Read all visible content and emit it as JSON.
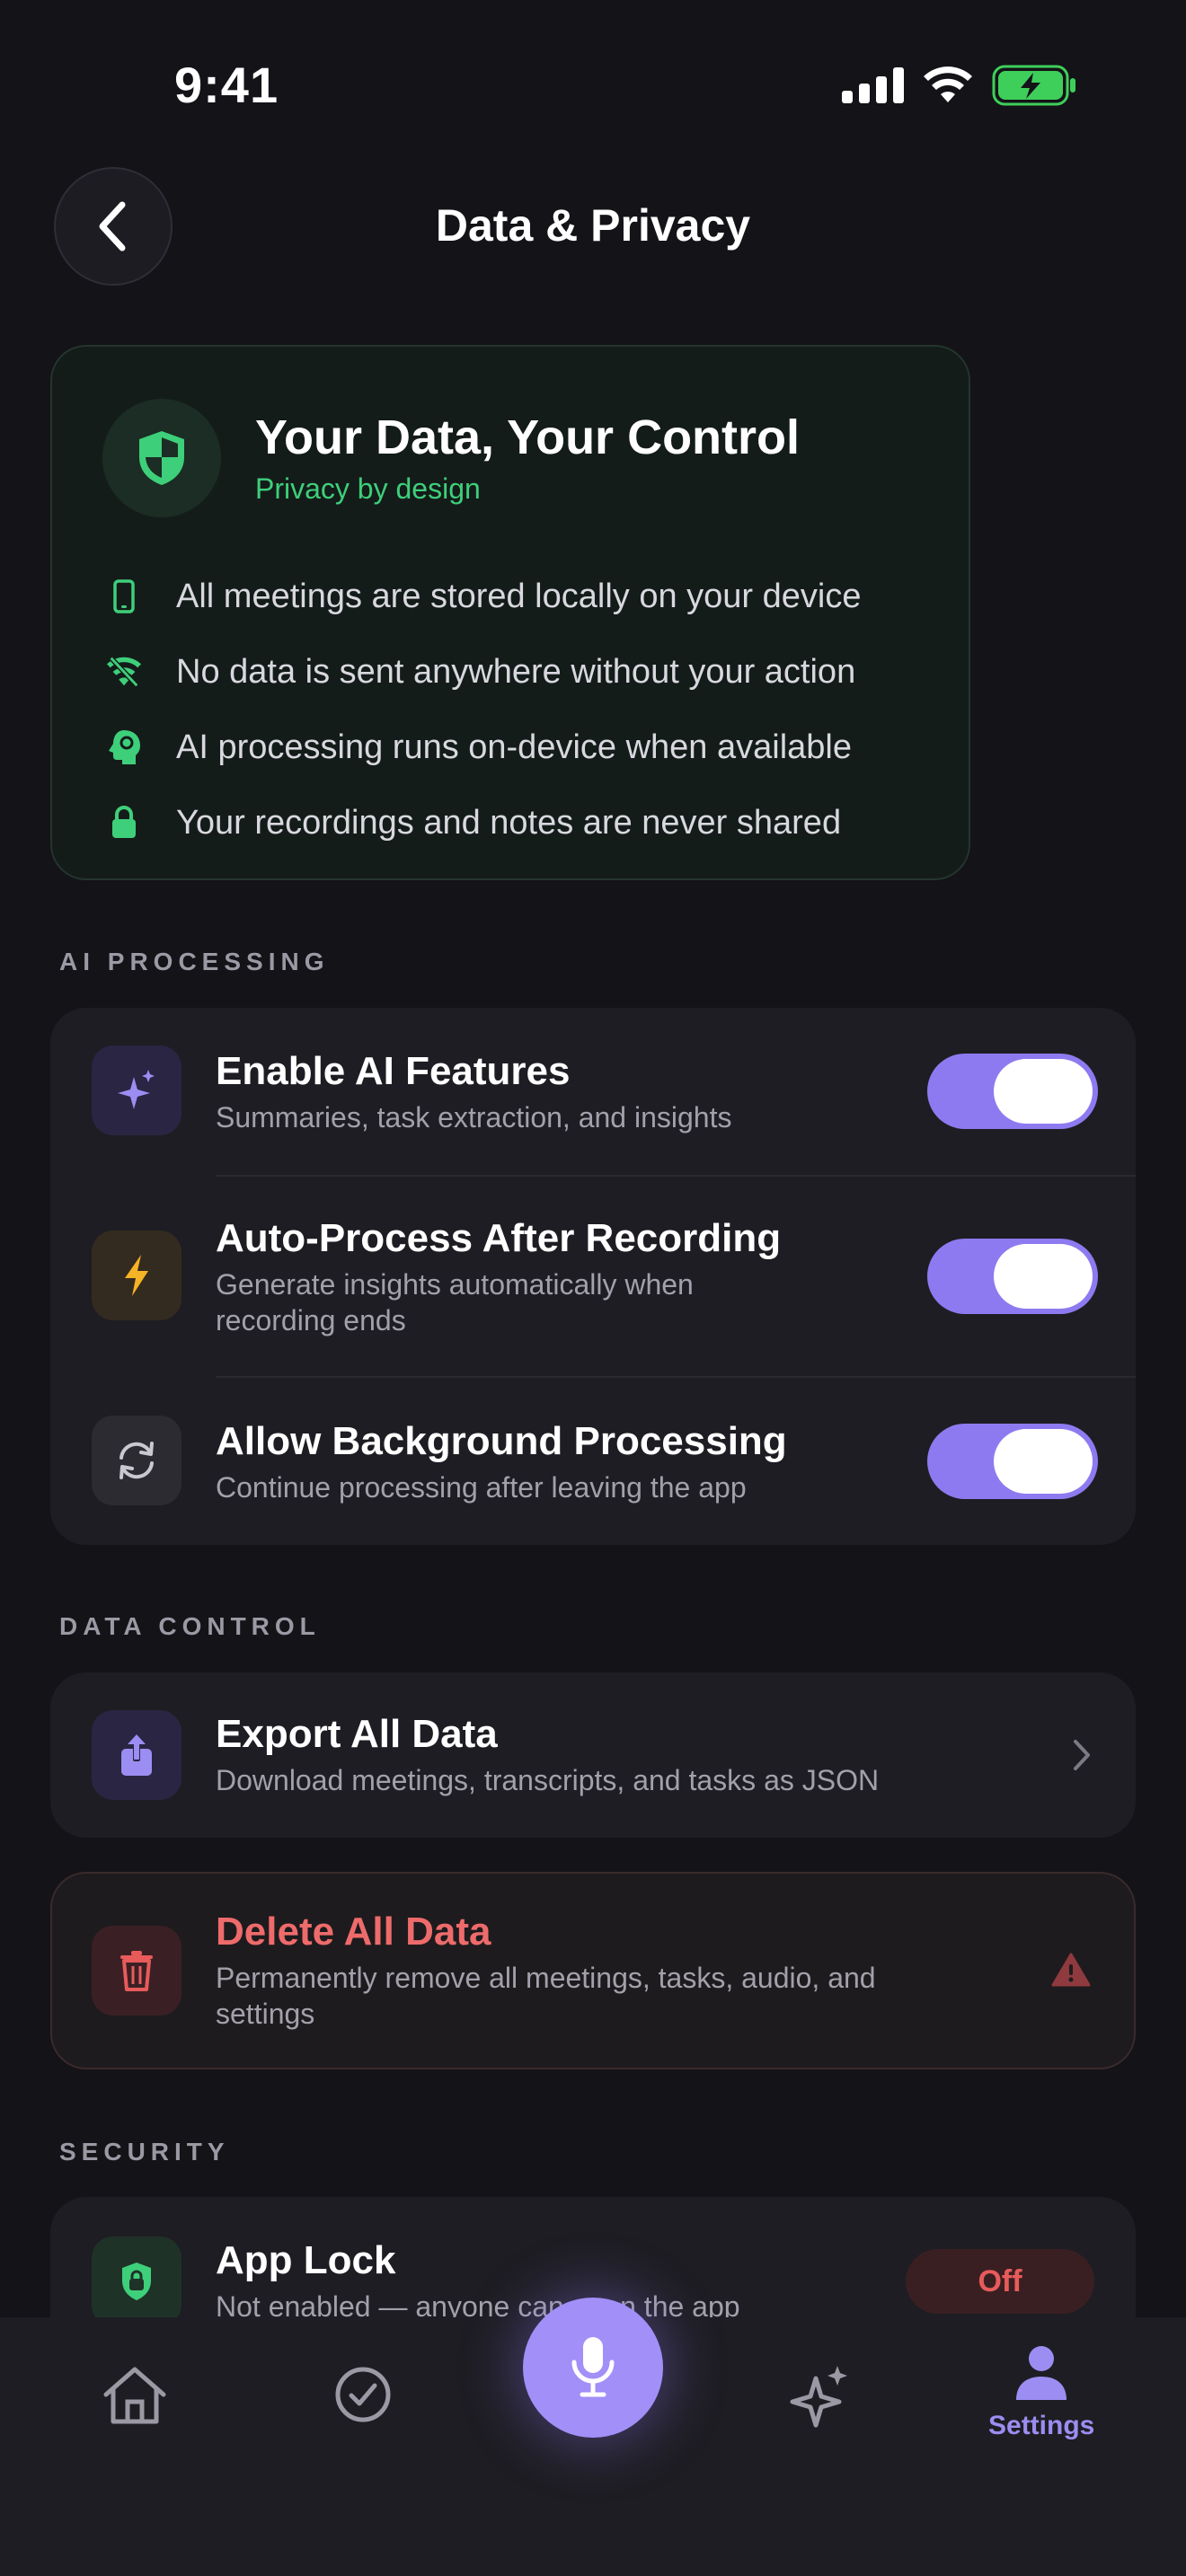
{
  "status_bar": {
    "time": "9:41"
  },
  "header": {
    "title": "Data & Privacy"
  },
  "privacy_card": {
    "title": "Your Data, Your Control",
    "subtitle": "Privacy by design",
    "bullets": [
      {
        "icon": "phone-icon",
        "text": "All meetings are stored locally on your device"
      },
      {
        "icon": "wifi-off-icon",
        "text": "No data is sent anywhere without your action"
      },
      {
        "icon": "brain-icon",
        "text": "AI processing runs on-device when available"
      },
      {
        "icon": "lock-icon",
        "text": "Your recordings and notes are never shared"
      }
    ]
  },
  "ai_processing": {
    "header": "AI PROCESSING",
    "items": [
      {
        "icon": "sparkle-icon",
        "title": "Enable AI Features",
        "subtitle": "Summaries, task extraction, and insights",
        "enabled": true
      },
      {
        "icon": "bolt-icon",
        "title": "Auto-Process After Recording",
        "subtitle": "Generate insights automatically when recording ends",
        "enabled": true
      },
      {
        "icon": "refresh-icon",
        "title": "Allow Background Processing",
        "subtitle": "Continue processing after leaving the app",
        "enabled": true
      }
    ]
  },
  "data_control": {
    "header": "DATA CONTROL",
    "export": {
      "icon": "share-icon",
      "title": "Export All Data",
      "subtitle": "Download meetings, transcripts, and tasks as JSON"
    },
    "delete": {
      "icon": "trash-icon",
      "title": "Delete All Data",
      "subtitle": "Permanently remove all meetings, tasks, audio, and settings"
    }
  },
  "security": {
    "header": "SECURITY",
    "app_lock": {
      "icon": "lock-icon",
      "title": "App Lock",
      "subtitle": "Not enabled — anyone can open the app",
      "status": "Off"
    }
  },
  "tabbar": {
    "tabs": [
      {
        "icon": "home-icon",
        "label": ""
      },
      {
        "icon": "check-circle-icon",
        "label": ""
      },
      {
        "icon": "microphone-icon",
        "label": ""
      },
      {
        "icon": "sparkle-icon",
        "label": ""
      },
      {
        "icon": "person-icon",
        "label": "Settings"
      }
    ],
    "active": "Settings"
  },
  "colors": {
    "background": "#141318",
    "accent": "#8e7af0",
    "privacy_green": "#3ecf7a",
    "danger": "#e85b5b"
  }
}
